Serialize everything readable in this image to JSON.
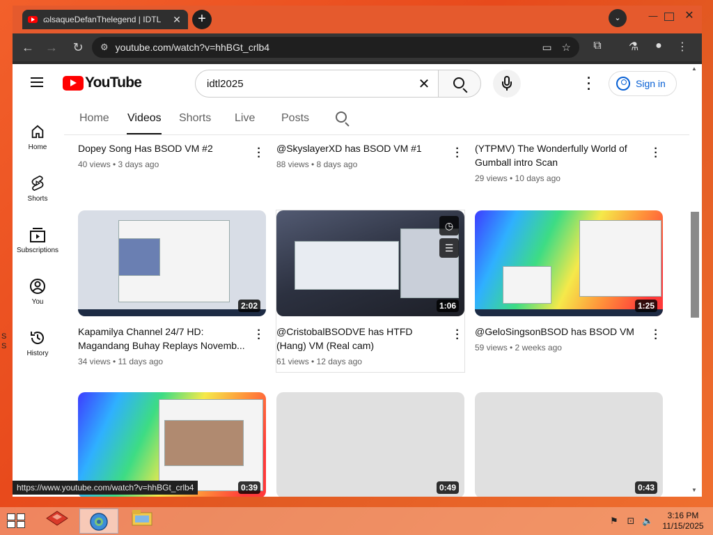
{
  "browser": {
    "tab_title": "ɷlsaqueDefanThelegend | IDTL",
    "url": "youtube.com/watch?v=hhBGt_crlb4",
    "status_url": "https://www.youtube.com/watch?v=hhBGt_crlb4"
  },
  "youtube": {
    "logo_text": "YouTube",
    "search_value": "idtl2025",
    "sign_in": "Sign in"
  },
  "guide": {
    "items": [
      {
        "label": "Home",
        "icon": "home-icon"
      },
      {
        "label": "Shorts",
        "icon": "shorts-icon"
      },
      {
        "label": "Subscriptions",
        "icon": "subscriptions-icon"
      },
      {
        "label": "You",
        "icon": "you-icon"
      },
      {
        "label": "History",
        "icon": "history-icon"
      }
    ]
  },
  "channel_tabs": [
    "Home",
    "Videos",
    "Shorts",
    "Live",
    "Posts"
  ],
  "videos": [
    {
      "title": "Dopey Song Has BSOD VM #2",
      "meta": "40 views • 3 days ago"
    },
    {
      "title": "@SkyslayerXD has BSOD VM #1",
      "meta": "88 views • 8 days ago"
    },
    {
      "title": "(YTPMV) The Wonderfully World of Gumball intro Scan",
      "meta": "29 views • 10 days ago"
    },
    {
      "title": "Kapamilya Channel 24/7 HD: Magandang Buhay Replays Novemb...",
      "meta": "34 views • 11 days ago",
      "duration": "2:02"
    },
    {
      "title": "@CristobalBSODVE has HTFD (Hang) VM (Real cam)",
      "meta": "61 views • 12 days ago",
      "duration": "1:06"
    },
    {
      "title": "@GeloSingsonBSOD has BSOD VM",
      "meta": "59 views • 2 weeks ago",
      "duration": "1:25"
    },
    {
      "duration": "0:39"
    },
    {
      "duration": "0:49"
    },
    {
      "duration": "0:43"
    }
  ],
  "desktop_text": "S\nS",
  "taskbar": {
    "time": "3:16 PM",
    "date": "11/15/2025"
  },
  "colors": {
    "accent": "#065fd4",
    "youtube_red": "#ff0000",
    "desktop": "#e84a1c"
  }
}
